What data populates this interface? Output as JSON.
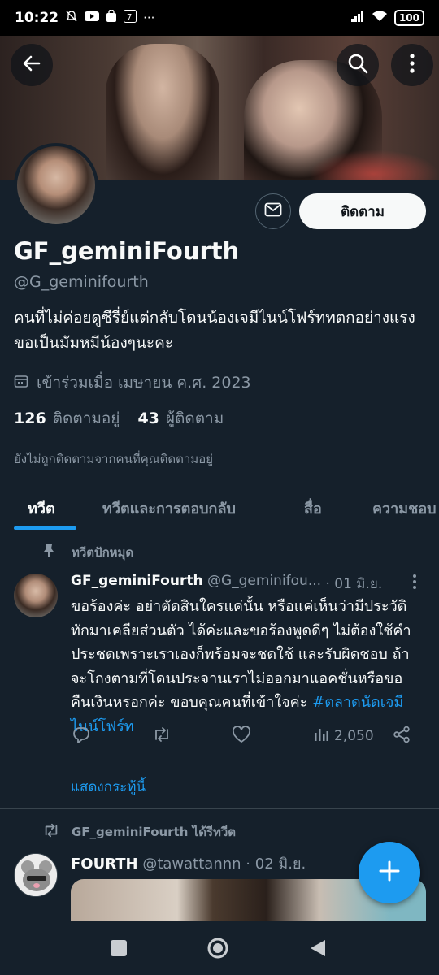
{
  "status_bar": {
    "time": "10:22",
    "battery": "100",
    "more": "···"
  },
  "header": {
    "back_label": "back",
    "search_label": "search",
    "more_label": "more"
  },
  "profile": {
    "display_name": "GF_geminiFourth",
    "handle": "@G_geminifourth",
    "bio_line1": "คนที่ไม่ค่อยดูซีรี่ย์แต่กลับโดนน้องเจมีไนน์โฟร์ททตกอย่างแรง",
    "bio_line2": "ขอเป็นมัมหมีน้องๆนะคะ",
    "joined": "เข้าร่วมเมื่อ เมษายน ค.ศ. 2023",
    "following_count": "126",
    "following_label": "ติดตามอยู่",
    "followers_count": "43",
    "followers_label": "ผู้ติดตาม",
    "not_followed_note": "ยังไม่ถูกติดตามจากคนที่คุณติดตามอยู่",
    "follow_button": "ติดตาม"
  },
  "tabs": [
    {
      "label": "ทวีต",
      "active": true
    },
    {
      "label": "ทวีตและการตอบกลับ",
      "active": false
    },
    {
      "label": "สื่อ",
      "active": false
    },
    {
      "label": "ความชอบ",
      "active": false
    }
  ],
  "tweet1": {
    "pinned_label": "ทวีตปักหมุด",
    "author_name": "GF_geminiFourth",
    "author_handle": "@G_geminifou...",
    "date": "· 01 มิ.ย.",
    "body": "ขอร้องค่ะ อย่าตัดสินใครแค่นั้น หรือแค่เห็นว่ามีประวัติ ทักมาเคลียส่วนตัว ได้ค่ะและขอร้องพูดดีๆ ไม่ต้องใช้คำประชดเพราะเราเองก็พร้อมจะชดใช้ และรับผิดชอบ ถ้าจะโกงตามที่โดนประจานเราไม่ออกมาแอคชั่นหรือขอคืนเงินหรอกค่ะ ขอบคุณคนที่เข้าใจค่ะ",
    "hashtag": "#ตลาดนัดเจมีไนน์โฟร์ท",
    "views": "2,050",
    "show_thread": "แสดงกระทู้นี้"
  },
  "tweet2": {
    "retweeted_label": "GF_geminiFourth ได้รีทวีต",
    "author_name": "FOURTH",
    "author_handle": "@tawattannn",
    "date": "· 02 มิ.ย."
  },
  "colors": {
    "background": "#15202b",
    "accent": "#1d9bf0",
    "secondary_text": "#8b98a5",
    "divider": "#38444d"
  },
  "icons": [
    "back-arrow-icon",
    "search-icon",
    "more-vertical-icon",
    "mail-icon",
    "calendar-icon",
    "pin-icon",
    "reply-icon",
    "retweet-icon",
    "like-icon",
    "analytics-icon",
    "share-icon",
    "compose-plus-icon"
  ]
}
